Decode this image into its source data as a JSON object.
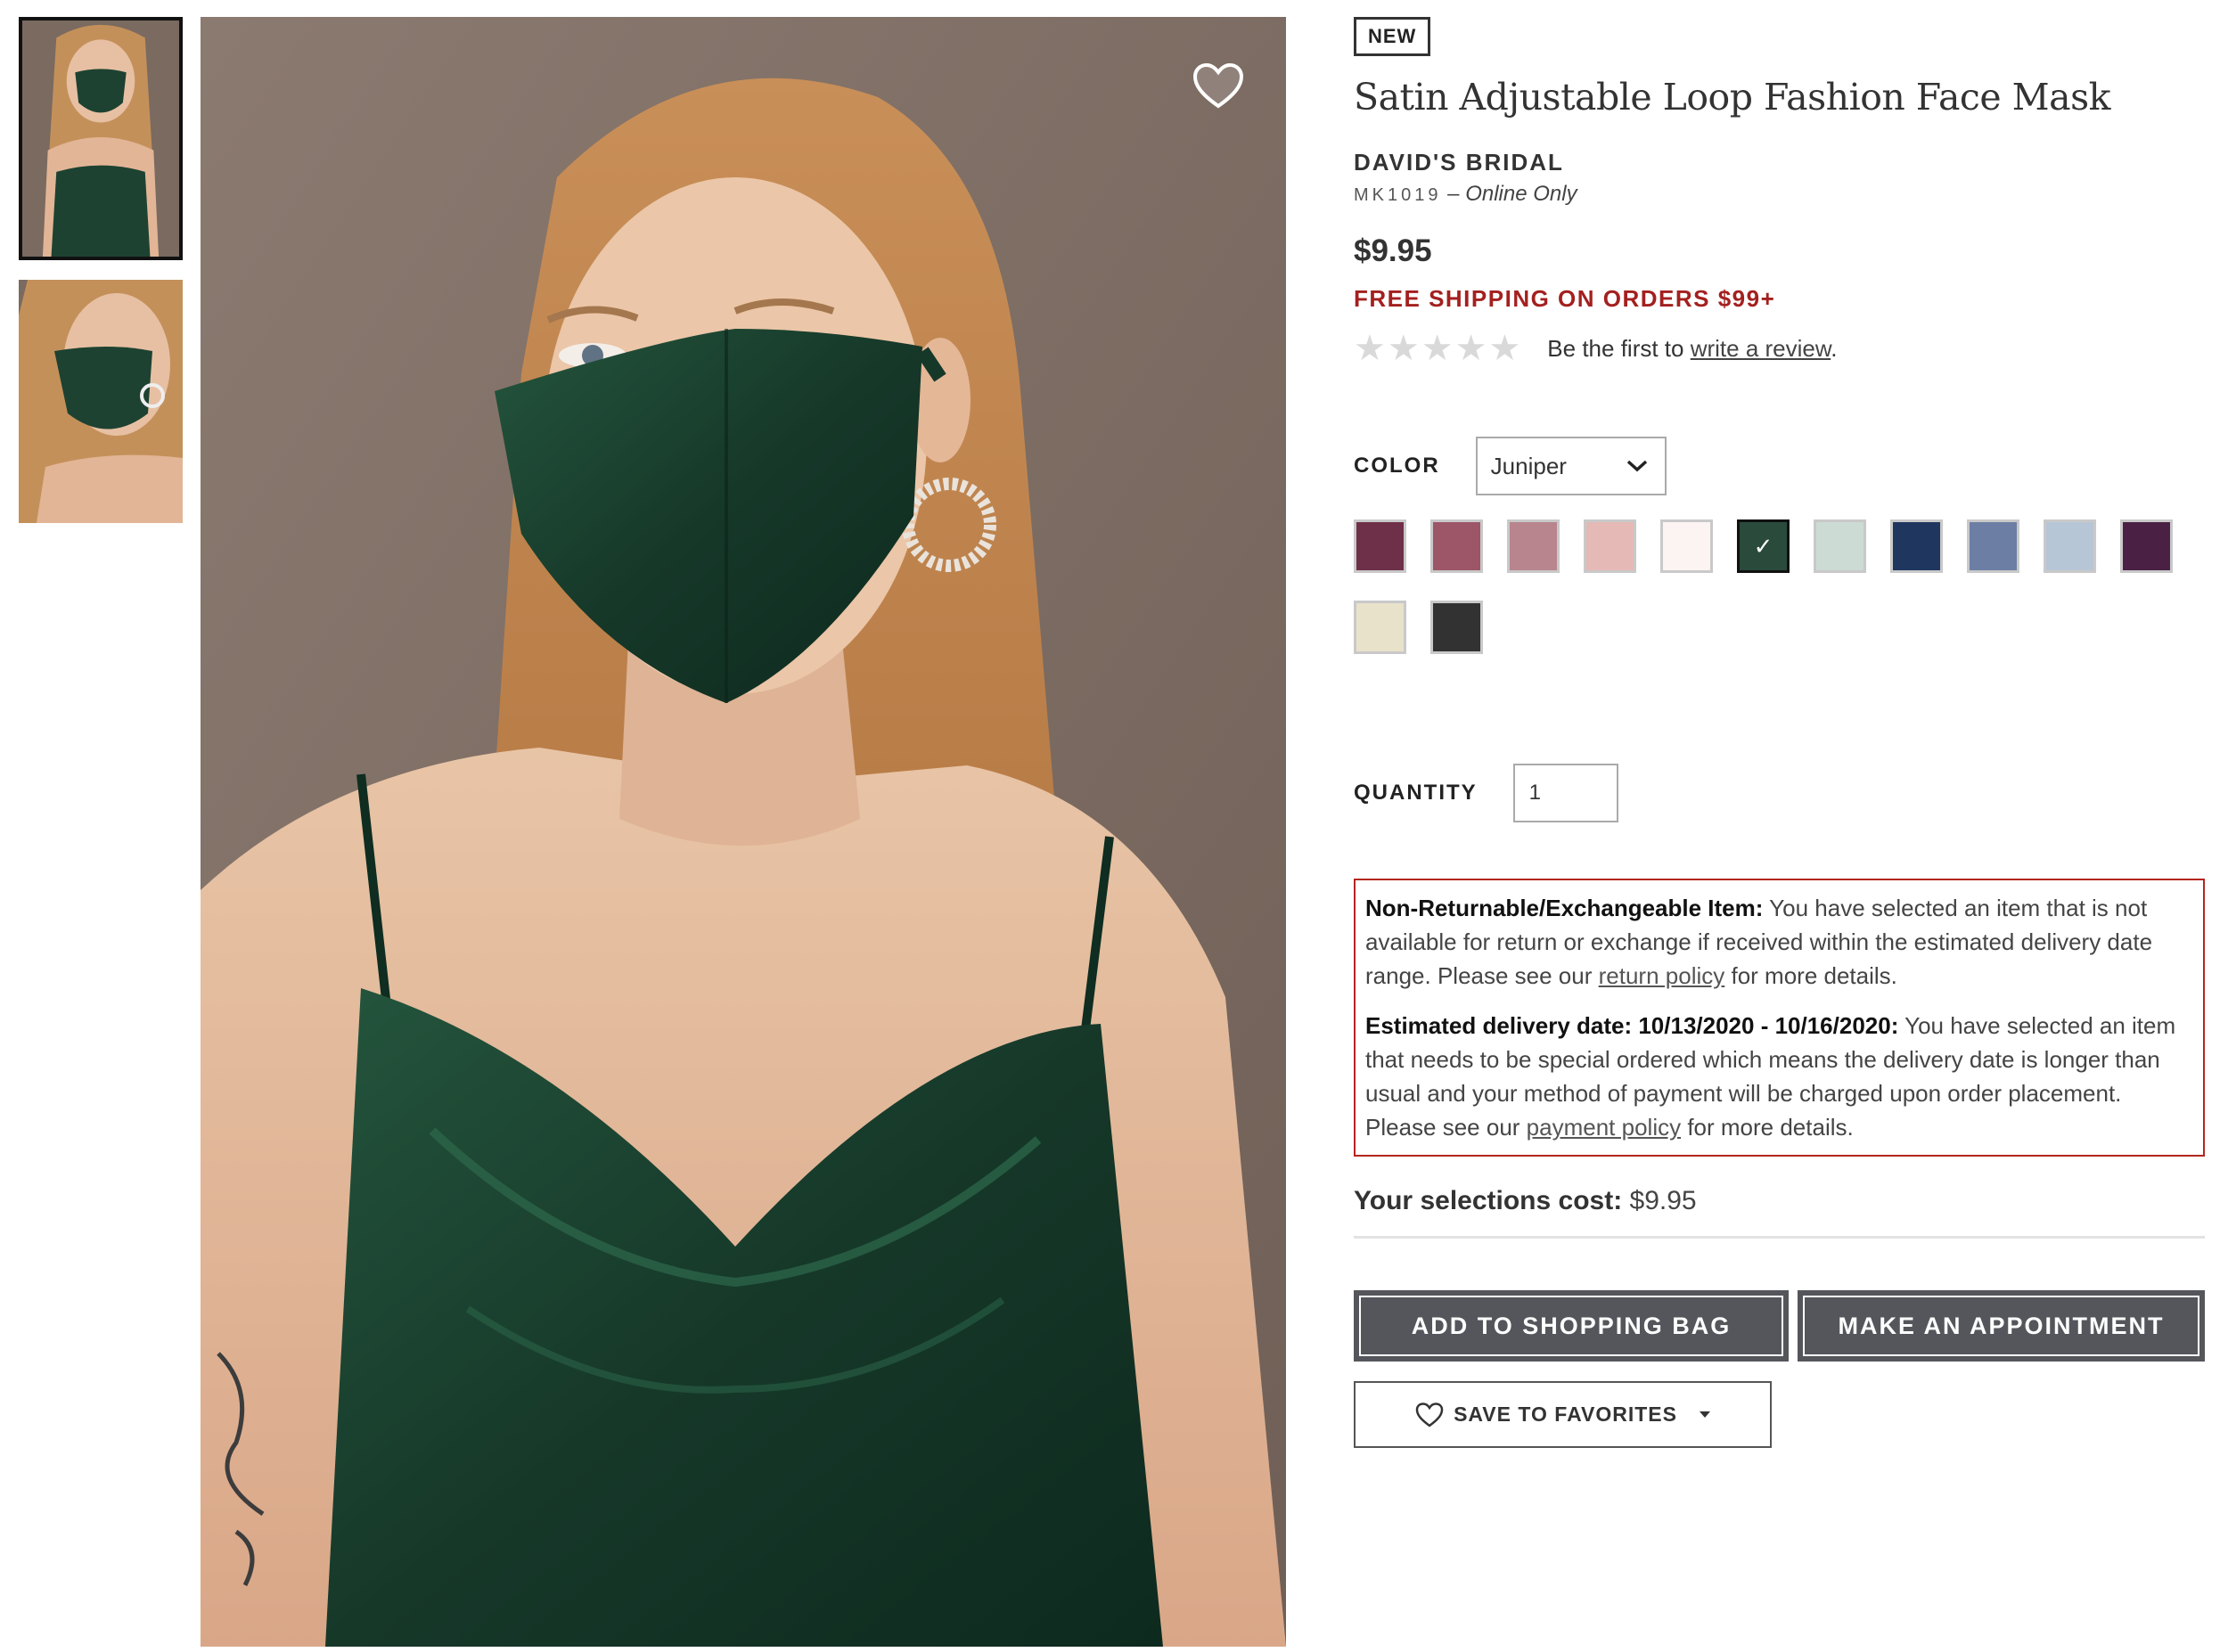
{
  "badge": "NEW",
  "product": {
    "title": "Satin Adjustable Loop Fashion Face Mask",
    "brand": "DAVID'S BRIDAL",
    "sku": "MK1019",
    "sku_separator": "–",
    "availability": "Online Only",
    "price": "$9.95",
    "shipping_promo": "FREE SHIPPING ON ORDERS $99+"
  },
  "rating": {
    "stars_filled": 0,
    "stars_total": 5,
    "prefix": "Be the first to ",
    "link": "write a review",
    "suffix": "."
  },
  "color": {
    "label": "COLOR",
    "selected": "Juniper",
    "icon": "chevron-down-icon",
    "swatches": [
      {
        "hex": "#6e2f48",
        "selected": false
      },
      {
        "hex": "#9c5668",
        "selected": false
      },
      {
        "hex": "#b8848e",
        "selected": false
      },
      {
        "hex": "#e5b9b6",
        "selected": false
      },
      {
        "hex": "#fbf4f2",
        "selected": false
      },
      {
        "hex": "#2a4a3c",
        "selected": true
      },
      {
        "hex": "#ccdbd3",
        "selected": false
      },
      {
        "hex": "#1f365f",
        "selected": false
      },
      {
        "hex": "#6c7ea4",
        "selected": false
      },
      {
        "hex": "#b7c6d6",
        "selected": false
      },
      {
        "hex": "#4a2145",
        "selected": false
      },
      {
        "hex": "#e9e2cb",
        "selected": false
      },
      {
        "hex": "#323232",
        "selected": false
      }
    ],
    "selected_check": "✓"
  },
  "quantity": {
    "label": "QUANTITY",
    "value": "1"
  },
  "notice": {
    "return_heading": "Non-Returnable/Exchangeable Item:",
    "return_text": " You have selected an item that is not available for return or exchange if received within the estimated delivery date range. Please see our ",
    "return_link": "return policy",
    "return_after": " for more details.",
    "delivery_heading": "Estimated delivery date: 10/13/2020 - 10/16/2020:",
    "delivery_text": " You have selected an item that needs to be special ordered which means the delivery date is longer than usual and your method of payment will be charged upon order placement. Please see our ",
    "delivery_link": "payment policy",
    "delivery_after": " for more details."
  },
  "cost": {
    "label": "Your selections cost:",
    "value": " $9.95"
  },
  "buttons": {
    "add_to_bag": "ADD TO SHOPPING BAG",
    "appointment": "MAKE AN APPOINTMENT",
    "save_favorites": "SAVE TO FAVORITES"
  },
  "icons": {
    "favorite": "heart-icon",
    "dropdown": "caret-down-icon"
  },
  "colors": {
    "promo_red": "#a3201f",
    "notice_border": "#b3261e",
    "button_dark": "#54565b",
    "mask_green": "#1d4231"
  }
}
